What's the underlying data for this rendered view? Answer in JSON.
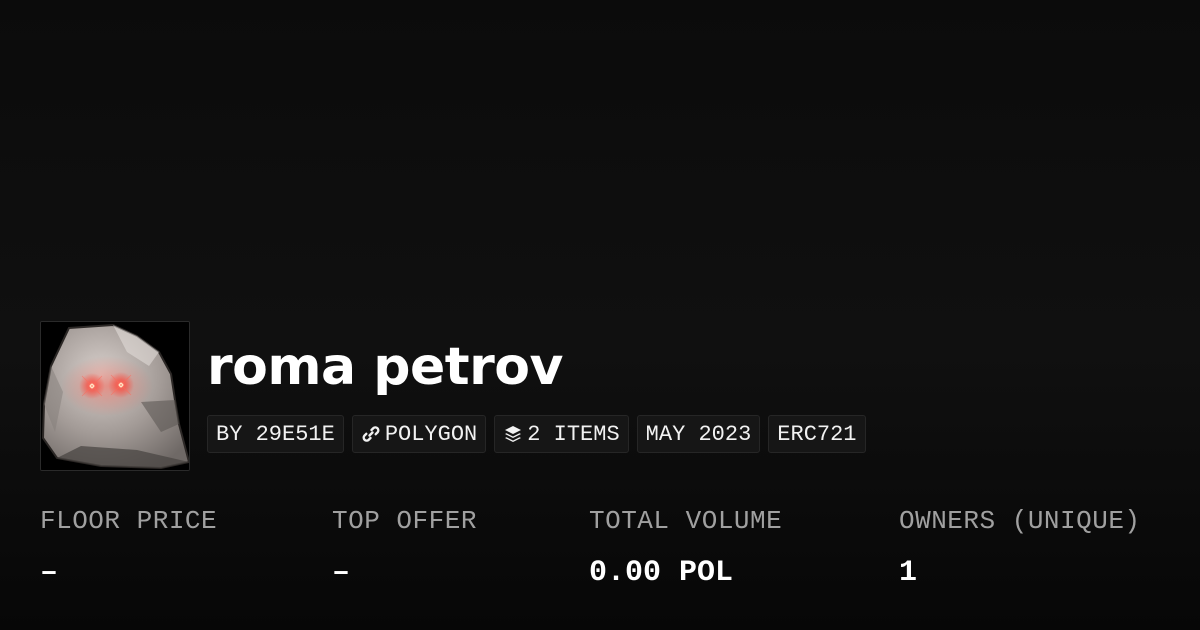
{
  "collection": {
    "name": "roma petrov",
    "avatar_icon": "rock-with-red-eyes-icon"
  },
  "badges": {
    "creator": "BY 29E51E",
    "chain": "POLYGON",
    "chain_icon": "chain-link-icon",
    "items": "2 ITEMS",
    "items_icon": "layers-icon",
    "date": "MAY 2023",
    "standard": "ERC721"
  },
  "stats": {
    "floor_price": {
      "label": "FLOOR PRICE",
      "value": "–"
    },
    "top_offer": {
      "label": "TOP OFFER",
      "value": "–"
    },
    "total_volume": {
      "label": "TOTAL VOLUME",
      "value": "0.00 POL"
    },
    "owners": {
      "label": "OWNERS (UNIQUE)",
      "value": "1"
    }
  },
  "colors": {
    "background": "#0b0b0b",
    "badge_background": "#161616",
    "label_gray": "#a0a0a0",
    "text_white": "#ffffff",
    "eye_red": "#ff3b2e"
  }
}
